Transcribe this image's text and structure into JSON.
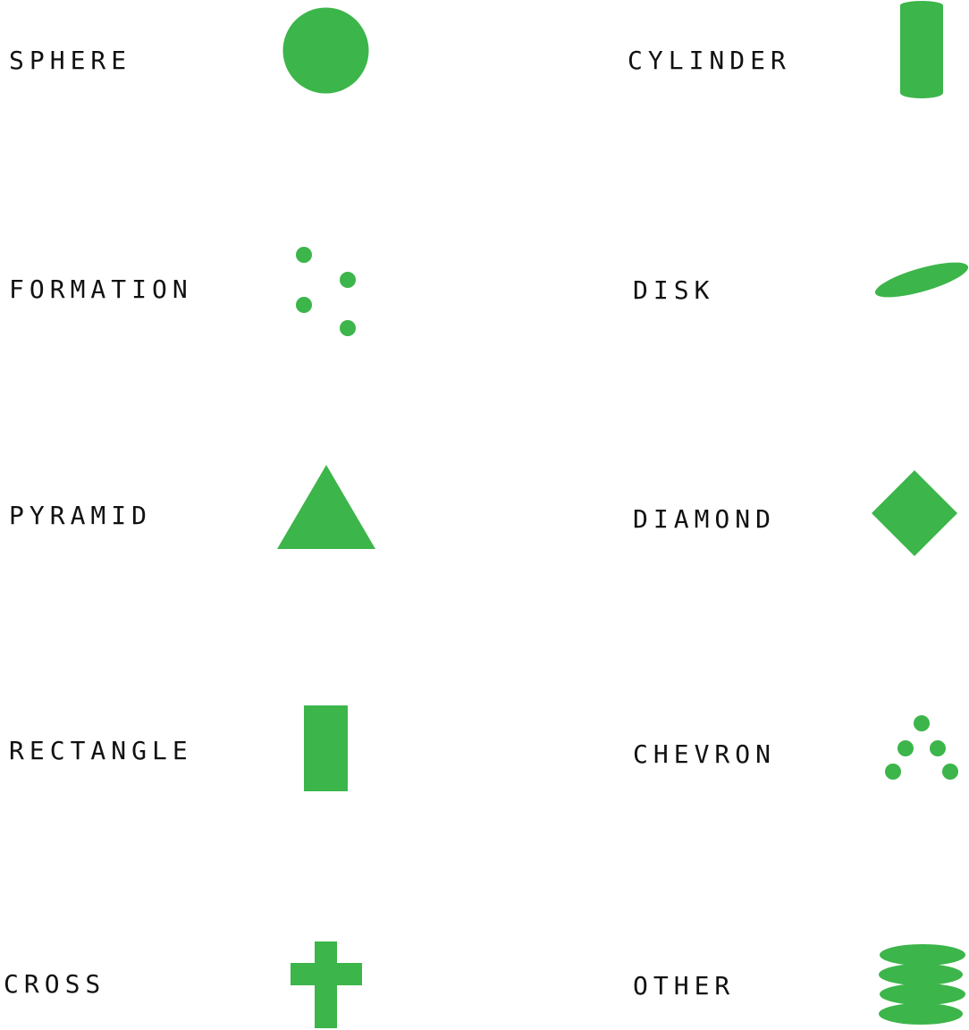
{
  "accent_color": "#3cb54a",
  "text_color": "#111111",
  "shapes": [
    {
      "label": "SPHERE",
      "icon": "sphere-icon"
    },
    {
      "label": "CYLINDER",
      "icon": "cylinder-icon"
    },
    {
      "label": "FORMATION",
      "icon": "formation-icon"
    },
    {
      "label": "DISK",
      "icon": "disk-icon"
    },
    {
      "label": "PYRAMID",
      "icon": "pyramid-icon"
    },
    {
      "label": "DIAMOND",
      "icon": "diamond-icon"
    },
    {
      "label": "RECTANGLE",
      "icon": "rectangle-icon"
    },
    {
      "label": "CHEVRON",
      "icon": "chevron-icon"
    },
    {
      "label": "CROSS",
      "icon": "cross-icon"
    },
    {
      "label": "OTHER",
      "icon": "other-icon"
    }
  ]
}
